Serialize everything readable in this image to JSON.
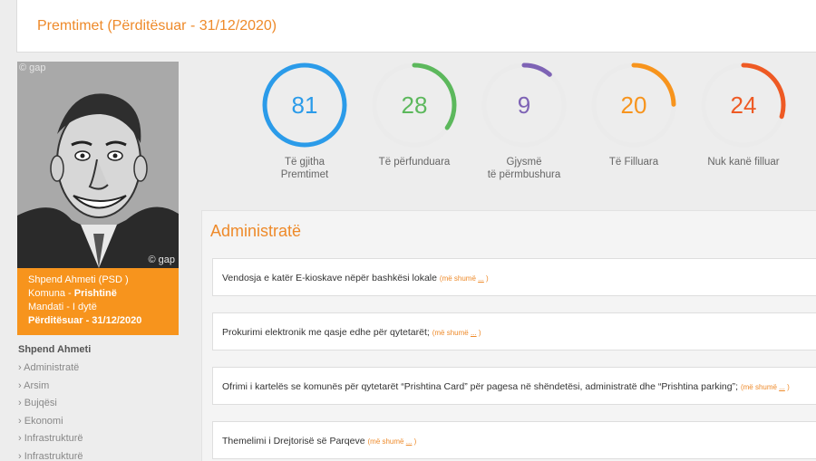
{
  "header": {
    "title": "Premtimet (Përditësuar - 31/12/2020)"
  },
  "profile": {
    "watermark": "© gap",
    "name_line": "Shpend Ahmeti (PSD )",
    "municipality_prefix": "Komuna - ",
    "municipality": "Prishtinë",
    "mandate": "Mandati - I dytë",
    "updated": "Përditësuar - 31/12/2020"
  },
  "nav": {
    "heading": "Shpend Ahmeti",
    "items": [
      "Administratë",
      "Arsim",
      "Bujqësi",
      "Ekonomi",
      "Infrastrukturë",
      "Infrastrukturë"
    ]
  },
  "stats": [
    {
      "value": "81",
      "line1": "Të gjitha",
      "line2": "Premtimet",
      "color": "#2b9be9",
      "fraction": 1.0
    },
    {
      "value": "28",
      "line1": "Të përfunduara",
      "line2": "",
      "color": "#5cb85c",
      "fraction": 0.3457
    },
    {
      "value": "9",
      "line1": "Gjysmë",
      "line2": "të përmbushura",
      "color": "#7e63b5",
      "fraction": 0.1111
    },
    {
      "value": "20",
      "line1": "Të Filluara",
      "line2": "",
      "color": "#f7941d",
      "fraction": 0.2469
    },
    {
      "value": "24",
      "line1": "Nuk kanë filluar",
      "line2": "",
      "color": "#ee5a24",
      "fraction": 0.2963
    }
  ],
  "section": {
    "title": "Administratë",
    "more_prefix": "(më shumë ",
    "more_link": "...",
    "more_suffix": " )",
    "items": [
      "Vendosja e katër E-kioskave nëpër bashkësi lokale",
      "Prokurimi elektronik me qasje edhe për qytetarët;",
      "Ofrimi i kartelës se komunës për qytetarët “Prishtina Card” për pagesa në shëndetësi, administratë dhe “Prishtina parking”;",
      "Themelimi i Drejtorisë së Parqeve"
    ]
  }
}
